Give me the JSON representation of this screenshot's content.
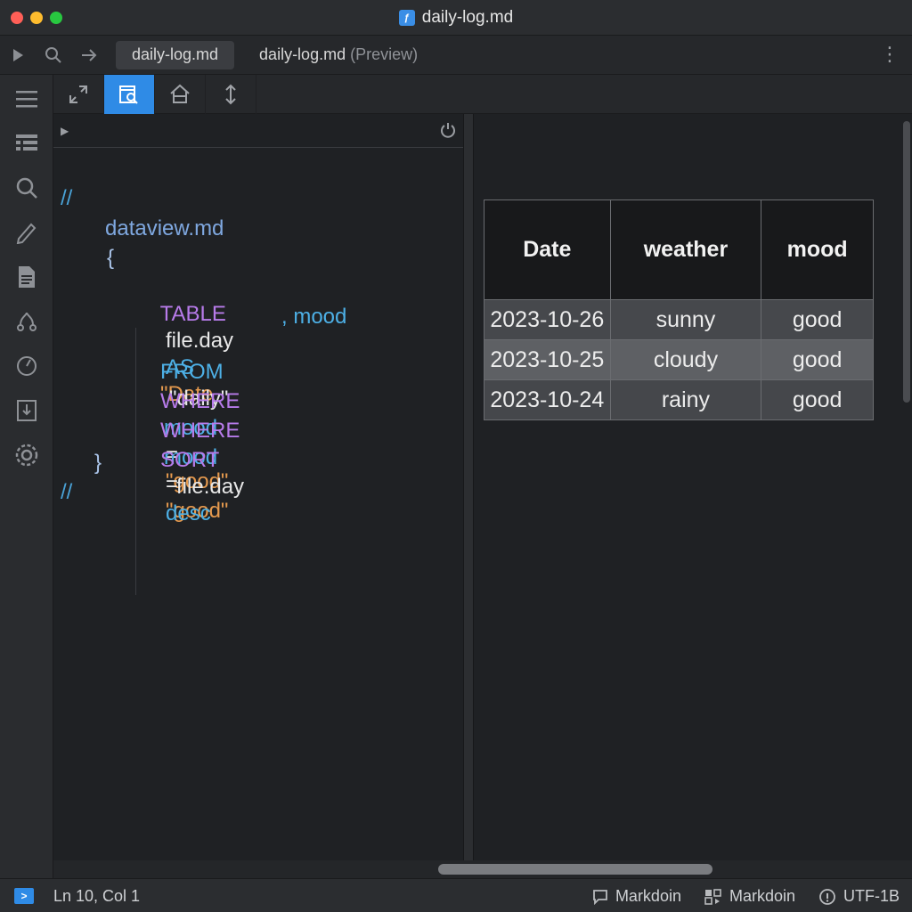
{
  "window": {
    "title": "daily-log.md"
  },
  "tabs": [
    {
      "label": "daily-log.md",
      "suffix": ""
    },
    {
      "label": "daily-log.md",
      "suffix": "(Preview)"
    }
  ],
  "editor": {
    "lines": [
      {
        "text": "//"
      },
      {
        "text": "dataview.md"
      },
      {
        "text": "{"
      },
      {
        "kw": "TABLE",
        "field": "file.day",
        "as": "AS",
        "str": "\"Date"
      },
      {
        "text": ", mood"
      },
      {
        "kw": "FROM",
        "str": "\"daily\""
      },
      {
        "kw": "WHERE",
        "field": "mood",
        "op": "=",
        "str": "\"good\""
      },
      {
        "kw": "WHERE",
        "field": "mood",
        "op": "=",
        "str": "\"good\""
      },
      {
        "kw": "SORT",
        "field": "file.day",
        "dir": "desc"
      },
      {
        "text": "}"
      },
      {
        "text": "//"
      }
    ]
  },
  "preview": {
    "table": {
      "headers": [
        "Date",
        "weather",
        "mood"
      ],
      "rows": [
        [
          "2023-10-26",
          "sunny",
          "good"
        ],
        [
          "2023-10-25",
          "cloudy",
          "good"
        ],
        [
          "2023-10-24",
          "rainy",
          "good"
        ]
      ]
    }
  },
  "status": {
    "position": "Ln 10, Col 1",
    "items": [
      "Markdoin",
      "Markdoin",
      "UTF-1B"
    ]
  },
  "colors": {
    "accent": "#2f8be6",
    "keyword": "#b77bea",
    "string": "#e69a4e",
    "identifier": "#4db0e6"
  }
}
